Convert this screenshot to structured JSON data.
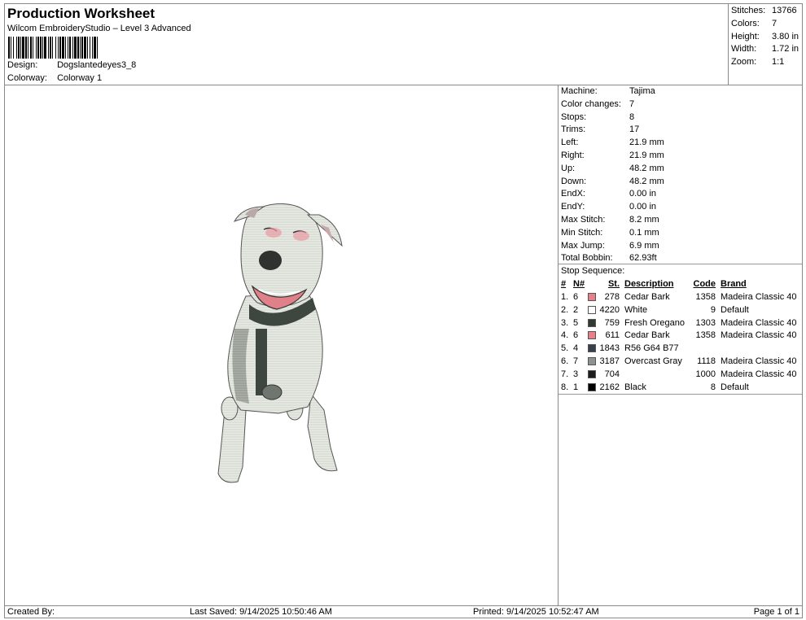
{
  "header": {
    "title": "Production Worksheet",
    "subtitle": "Wilcom EmbroideryStudio – Level 3 Advanced",
    "design_label": "Design:",
    "design_value": "Dogslantedeyes3_8",
    "colorway_label": "Colorway:",
    "colorway_value": "Colorway 1"
  },
  "summary": [
    {
      "label": "Stitches:",
      "value": "13766"
    },
    {
      "label": "Colors:",
      "value": "7"
    },
    {
      "label": "Height:",
      "value": "3.80 in"
    },
    {
      "label": "Width:",
      "value": "1.72 in"
    },
    {
      "label": "Zoom:",
      "value": "1:1"
    }
  ],
  "details": [
    {
      "label": "Machine:",
      "value": "Tajima"
    },
    {
      "label": "Color changes:",
      "value": "7"
    },
    {
      "label": "Stops:",
      "value": "8"
    },
    {
      "label": "Trims:",
      "value": "17"
    },
    {
      "label": "Left:",
      "value": "21.9 mm"
    },
    {
      "label": "Right:",
      "value": "21.9 mm"
    },
    {
      "label": "Up:",
      "value": "48.2 mm"
    },
    {
      "label": "Down:",
      "value": "48.2 mm"
    },
    {
      "label": "EndX:",
      "value": "0.00 in"
    },
    {
      "label": "EndY:",
      "value": "0.00 in"
    },
    {
      "label": "Max Stitch:",
      "value": "8.2 mm"
    },
    {
      "label": "Min Stitch:",
      "value": "0.1 mm"
    },
    {
      "label": "Max Jump:",
      "value": "6.9 mm"
    },
    {
      "label": "Total Bobbin:",
      "value": "62.93ft"
    }
  ],
  "stop_sequence": {
    "title": "Stop Sequence:",
    "headers": {
      "num": "#",
      "n": "N#",
      "st": "St.",
      "desc": "Description",
      "code": "Code",
      "brand": "Brand"
    },
    "rows": [
      {
        "num": "1.",
        "n": "6",
        "color": "#e8808a",
        "st": "278",
        "desc": "Cedar Bark",
        "code": "1358",
        "brand": "Madeira Classic 40"
      },
      {
        "num": "2.",
        "n": "2",
        "color": "#ffffff",
        "st": "4220",
        "desc": "White",
        "code": "9",
        "brand": "Default"
      },
      {
        "num": "3.",
        "n": "5",
        "color": "#2f3a30",
        "st": "759",
        "desc": "Fresh Oregano",
        "code": "1303",
        "brand": "Madeira Classic 40"
      },
      {
        "num": "4.",
        "n": "6",
        "color": "#e8808a",
        "st": "611",
        "desc": "Cedar Bark",
        "code": "1358",
        "brand": "Madeira Classic 40"
      },
      {
        "num": "5.",
        "n": "4",
        "color": "#38404d",
        "st": "1843",
        "desc": "R56 G64 B77",
        "code": "",
        "brand": ""
      },
      {
        "num": "6.",
        "n": "7",
        "color": "#8e9290",
        "st": "3187",
        "desc": "Overcast Gray",
        "code": "1118",
        "brand": "Madeira Classic 40"
      },
      {
        "num": "7.",
        "n": "3",
        "color": "#1c1c1c",
        "st": "704",
        "desc": "",
        "code": "1000",
        "brand": "Madeira Classic 40"
      },
      {
        "num": "8.",
        "n": "1",
        "color": "#000000",
        "st": "2162",
        "desc": "Black",
        "code": "8",
        "brand": "Default"
      }
    ]
  },
  "footer": {
    "created_by": "Created By:",
    "last_saved": "Last Saved: 9/14/2025 10:50:46 AM",
    "printed": "Printed: 9/14/2025 10:52:47 AM",
    "page": "Page 1 of 1"
  }
}
